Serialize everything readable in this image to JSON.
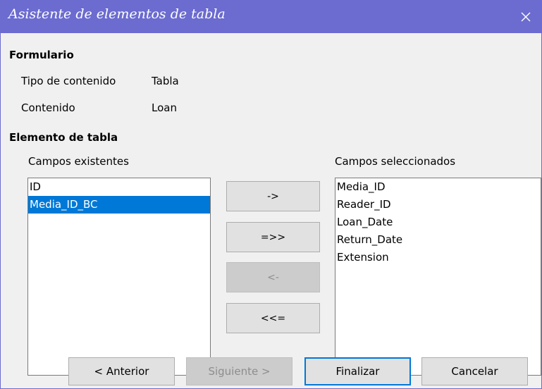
{
  "window": {
    "title": "Asistente de elementos de tabla",
    "close_icon": "close-icon",
    "accent_color": "#6b6bd0"
  },
  "form": {
    "heading": "Formulario",
    "content_type_label": "Tipo de contenido",
    "content_type_value": "Tabla",
    "content_label": "Contenido",
    "content_value": "Loan"
  },
  "table_element": {
    "heading": "Elemento de tabla",
    "existing_label": "Campos existentes",
    "selected_label": "Campos seleccionados",
    "existing_fields": [
      "ID",
      "Media_ID_BC"
    ],
    "existing_selected": "Media_ID_BC",
    "selected_fields": [
      "Media_ID",
      "Reader_ID",
      "Loan_Date",
      "Return_Date",
      "Extension"
    ]
  },
  "move_buttons": {
    "add_one": "->",
    "add_all": "=>>",
    "remove_one": "<-",
    "remove_all": "<<="
  },
  "footer": {
    "back": "< Anterior",
    "next": "Siguiente >",
    "finish": "Finalizar",
    "cancel": "Cancelar"
  }
}
